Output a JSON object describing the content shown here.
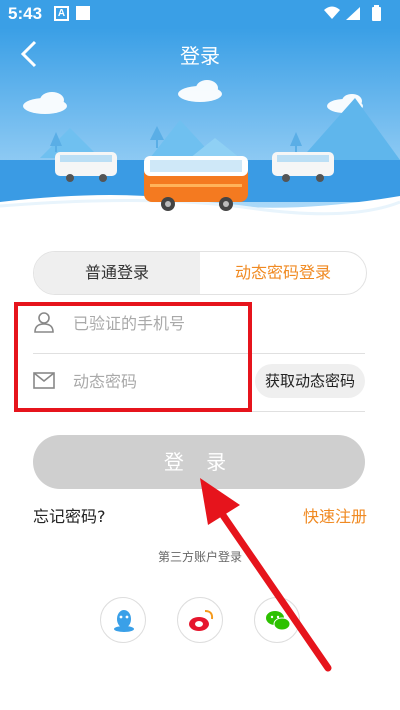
{
  "status_bar": {
    "time": "5:43",
    "notif_letter": "A"
  },
  "header": {
    "title": "登录"
  },
  "tabs": [
    {
      "label": "普通登录",
      "active": false
    },
    {
      "label": "动态密码登录",
      "active": true
    }
  ],
  "form": {
    "phone_placeholder": "已验证的手机号",
    "code_placeholder": "动态密码",
    "get_code_label": "获取动态密码"
  },
  "login_button_label": "登 录",
  "forgot_password": "忘记密码?",
  "quick_register": "快速注册",
  "third_party_label": "第三方账户登录",
  "social": [
    {
      "name": "qq-icon",
      "color": "#3aa0e8"
    },
    {
      "name": "weibo-icon",
      "color": "#e6162d"
    },
    {
      "name": "wechat-icon",
      "color": "#2dc100"
    }
  ],
  "colors": {
    "accent": "#f08a22",
    "header_blue": "#3a9fe6",
    "annotation_red": "#e6141c"
  }
}
